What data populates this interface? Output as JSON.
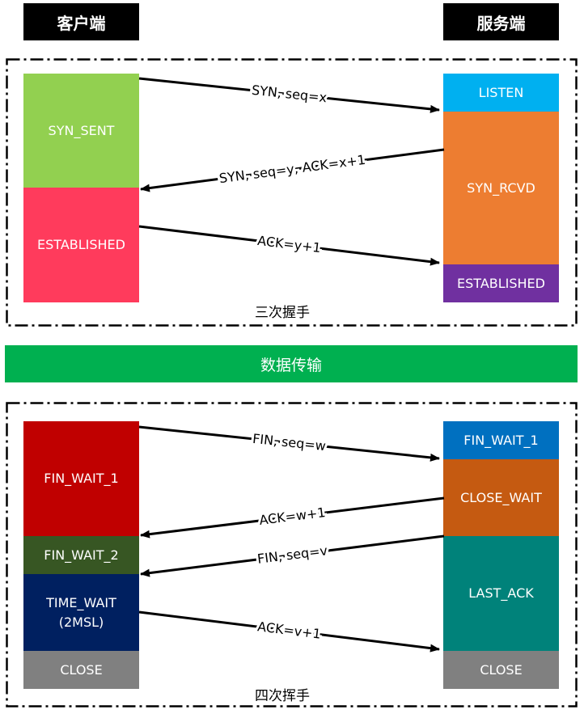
{
  "headers": {
    "client": "客户端",
    "server": "服务端"
  },
  "handshake": {
    "caption": "三次握手",
    "client_states": [
      "SYN_SENT",
      "ESTABLISHED"
    ],
    "server_states": [
      "LISTEN",
      "SYN_RCVD",
      "ESTABLISHED"
    ],
    "messages": [
      {
        "label": "SYN, seq=x",
        "direction": "client-to-server"
      },
      {
        "label": "SYN, seq=y, ACK=x+1",
        "direction": "server-to-client"
      },
      {
        "label": "ACK=y+1",
        "direction": "client-to-server"
      }
    ]
  },
  "transfer": {
    "label": "数据传输"
  },
  "teardown": {
    "caption": "四次挥手",
    "client_states": [
      "FIN_WAIT_1",
      "FIN_WAIT_2",
      "TIME_WAIT\n(2MSL)",
      "CLOSE"
    ],
    "server_states": [
      "FIN_WAIT_1",
      "CLOSE_WAIT",
      "LAST_ACK",
      "CLOSE"
    ],
    "messages": [
      {
        "label": "FIN, seq=w",
        "direction": "client-to-server"
      },
      {
        "label": "ACK=w+1",
        "direction": "server-to-client"
      },
      {
        "label": "FIN, seq=v",
        "direction": "server-to-client"
      },
      {
        "label": "ACK=v+1",
        "direction": "client-to-server"
      }
    ]
  },
  "colors": {
    "syn_sent": "#92d050",
    "established_client": "#ff3b5c",
    "listen": "#00b0f0",
    "syn_rcvd": "#ed7d31",
    "established_server": "#7030a0",
    "transfer": "#00b050",
    "fin_wait_1_client": "#c00000",
    "fin_wait_2": "#375623",
    "time_wait": "#002060",
    "close": "#808080",
    "fin_wait_1_server": "#0070c0",
    "close_wait": "#c55a11",
    "last_ack": "#00827a"
  }
}
